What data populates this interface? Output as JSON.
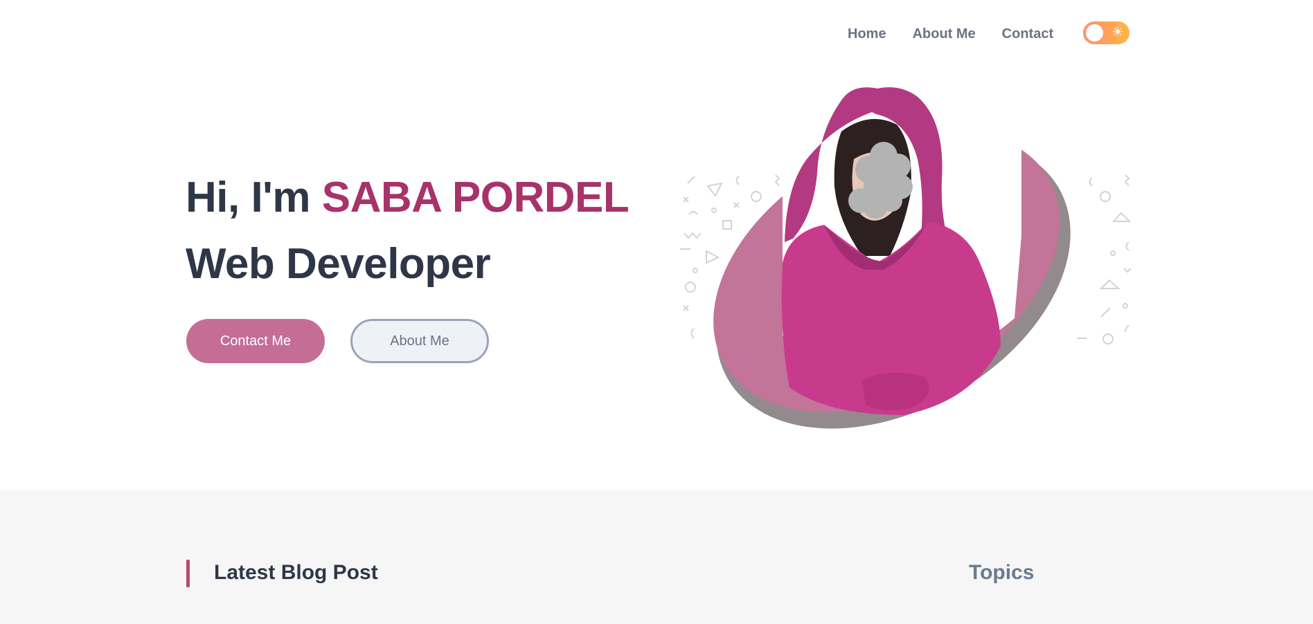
{
  "nav": {
    "links": [
      "Home",
      "About Me",
      "Contact"
    ],
    "theme_toggle": {
      "state": "light",
      "icon": "sun-icon",
      "gradient": [
        "#ff8f6b",
        "#ffb547"
      ]
    }
  },
  "hero": {
    "greeting": "Hi, I'm",
    "name": "SABA PORDEL",
    "role": "Web Developer",
    "contact_button": "Contact Me",
    "about_button": "About Me",
    "portrait": {
      "description_icon": "portrait-image",
      "accent": "#c46e96",
      "shadow": "#938a8e"
    }
  },
  "blog": {
    "title": "Latest Blog Post",
    "topics_title": "Topics"
  },
  "colors": {
    "accent": "#a8326a",
    "button_primary": "#c46e96",
    "text_dark": "#2e3748",
    "text_muted": "#6b7285"
  }
}
